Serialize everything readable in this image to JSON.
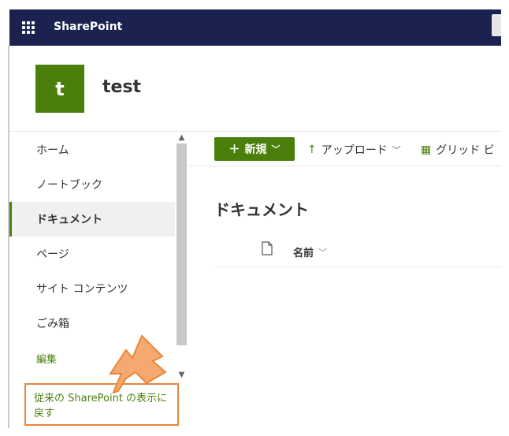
{
  "suitebar": {
    "brand": "SharePoint"
  },
  "site": {
    "logo_letter": "t",
    "name": "test"
  },
  "nav": {
    "items": [
      {
        "label": "ホーム"
      },
      {
        "label": "ノートブック"
      },
      {
        "label": "ドキュメント",
        "active": true
      },
      {
        "label": "ページ"
      },
      {
        "label": "サイト コンテンツ"
      },
      {
        "label": "ごみ箱"
      }
    ],
    "edit_label": "編集",
    "revert_label": "従来の SharePoint の表示に戻す"
  },
  "commandbar": {
    "new_label": "新規",
    "upload_label": "アップロード",
    "grid_label": "グリッド ビ"
  },
  "library": {
    "title": "ドキュメント",
    "column_name": "名前"
  },
  "colors": {
    "suitebar": "#1b2250",
    "accent": "#4a7f0b",
    "highlight": "#e9863a"
  }
}
